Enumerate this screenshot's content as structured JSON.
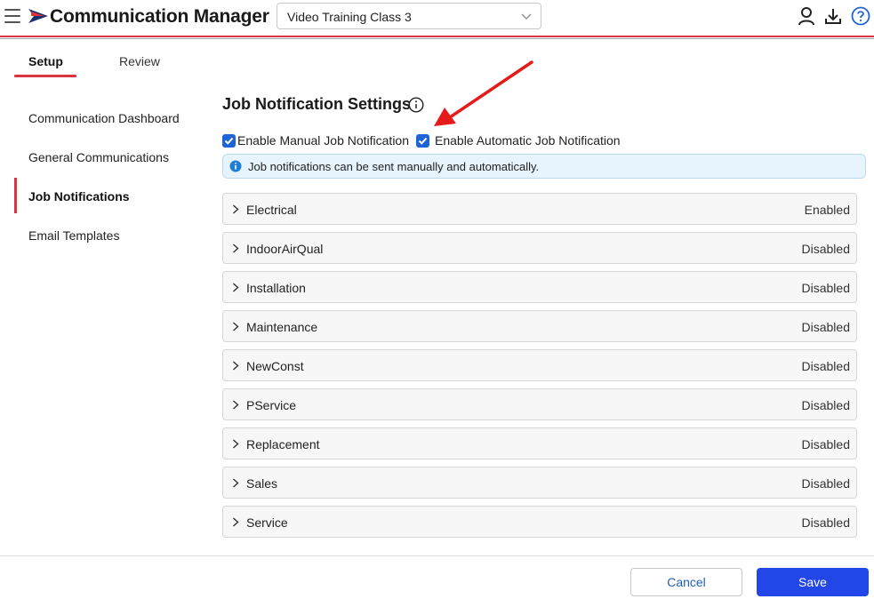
{
  "header": {
    "app_title": "Communication Manager",
    "selected_class": "Video Training Class 3",
    "accent_color": "#d9343f",
    "icons": [
      "hamburger-menu-icon",
      "logo-icon",
      "user-icon",
      "download-icon",
      "help-icon"
    ]
  },
  "tabs": [
    {
      "label": "Setup",
      "active": true
    },
    {
      "label": "Review",
      "active": false
    }
  ],
  "sidebar": {
    "items": [
      {
        "label": "Communication Dashboard",
        "active": false
      },
      {
        "label": "General Communications",
        "active": false
      },
      {
        "label": "Job Notifications",
        "active": true
      },
      {
        "label": "Email Templates",
        "active": false
      }
    ]
  },
  "main": {
    "title": "Job Notification Settings",
    "checkbox_manual": {
      "label": "Enable Manual Job Notification",
      "checked": true
    },
    "checkbox_auto": {
      "label": "Enable Automatic Job Notification",
      "checked": true
    },
    "info_text": "Job notifications can be sent manually and automatically.",
    "job_types": [
      {
        "label": "Electrical",
        "status": "Enabled"
      },
      {
        "label": "IndoorAirQual",
        "status": "Disabled"
      },
      {
        "label": "Installation",
        "status": "Disabled"
      },
      {
        "label": "Maintenance",
        "status": "Disabled"
      },
      {
        "label": "NewConst",
        "status": "Disabled"
      },
      {
        "label": "PService",
        "status": "Disabled"
      },
      {
        "label": "Replacement",
        "status": "Disabled"
      },
      {
        "label": "Sales",
        "status": "Disabled"
      },
      {
        "label": "Service",
        "status": "Disabled"
      }
    ]
  },
  "footer": {
    "cancel_label": "Cancel",
    "save_label": "Save",
    "save_color": "#2346e8"
  }
}
